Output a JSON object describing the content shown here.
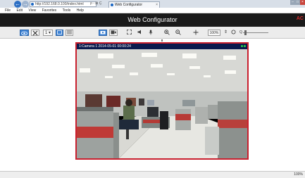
{
  "browser": {
    "address": "http://192.168.0.100/index.html",
    "address_tools": "ρ - ⊠ Ç",
    "tab_title": "Web Configurator",
    "tab_close": "×",
    "nav_back": "←",
    "nav_forward": "→",
    "window_controls": [
      "–",
      "□",
      "×"
    ],
    "menu": [
      "File",
      "Edit",
      "View",
      "Favorites",
      "Tools",
      "Help"
    ]
  },
  "app": {
    "title": "Web Configurator",
    "brand": "AC"
  },
  "toolbar": {
    "stream_select": "1",
    "ratio_select": "100%",
    "zoom_icon": "Q"
  },
  "video": {
    "label": "1:Camera 1   2014-05-01 00:00:24"
  },
  "status": {
    "zoom": "100%"
  },
  "icons": {
    "live-view": "eye-icon",
    "settings": "tools-icon",
    "snapshot": "camera-icon",
    "record": "record-icon",
    "fullscreen": "fullscreen-icon",
    "audio": "microphone-icon",
    "zoom-in": "zoom-in-icon",
    "zoom-out": "zoom-out-icon",
    "ptz": "move-icon"
  },
  "colors": {
    "header": "#1a1a1a",
    "accent_blue": "#3d82d4",
    "video_border": "#c9202e",
    "label_bar": "#0b1a4d"
  }
}
